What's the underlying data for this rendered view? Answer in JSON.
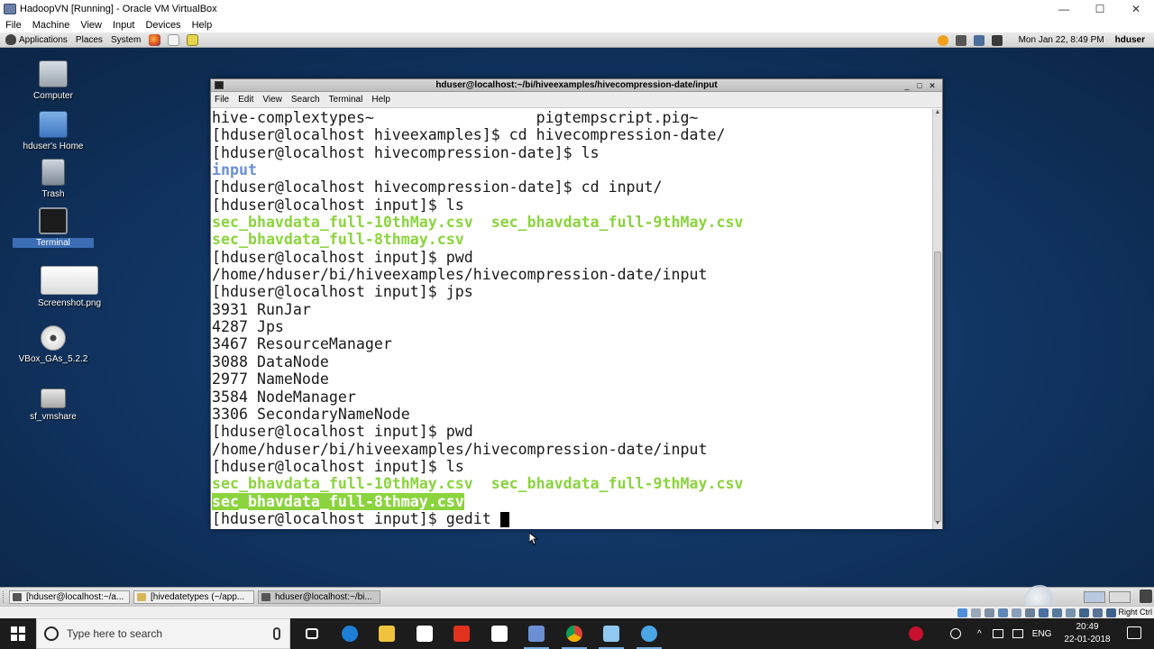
{
  "host_window": {
    "title": "HadoopVN [Running] - Oracle VM VirtualBox",
    "menu": [
      "File",
      "Machine",
      "View",
      "Input",
      "Devices",
      "Help"
    ],
    "controls": {
      "minimize": "—",
      "maximize": "☐",
      "close": "✕"
    }
  },
  "guest_panel": {
    "menus": [
      "Applications",
      "Places",
      "System"
    ],
    "clock": "Mon Jan 22,  8:49 PM",
    "user": "hduser"
  },
  "desktop_icons": [
    {
      "label": "Computer",
      "icon": "computer-icon",
      "selected": false
    },
    {
      "label": "hduser's Home",
      "icon": "home-folder-icon",
      "selected": false
    },
    {
      "label": "Trash",
      "icon": "trash-icon",
      "selected": false
    },
    {
      "label": "Terminal",
      "icon": "terminal-icon",
      "selected": true
    },
    {
      "label": "Screenshot.png",
      "icon": "image-file-icon",
      "selected": false
    },
    {
      "label": "VBox_GAs_5.2.2",
      "icon": "cd-icon",
      "selected": false
    },
    {
      "label": "sf_vmshare",
      "icon": "drive-icon",
      "selected": false
    }
  ],
  "terminal": {
    "title": "hduser@localhost:~/bi/hiveexamples/hivecompression-date/input",
    "menu": [
      "File",
      "Edit",
      "View",
      "Search",
      "Terminal",
      "Help"
    ],
    "lines": [
      [
        {
          "t": "hive-complextypes~                  pigtempscript.pig~",
          "c": ""
        }
      ],
      [
        {
          "t": "[hduser@localhost hiveexamples]$ cd hivecompression-date/",
          "c": ""
        }
      ],
      [
        {
          "t": "[hduser@localhost hivecompression-date]$ ls",
          "c": ""
        }
      ],
      [
        {
          "t": "input",
          "c": "blue"
        }
      ],
      [
        {
          "t": "[hduser@localhost hivecompression-date]$ cd input/",
          "c": ""
        }
      ],
      [
        {
          "t": "[hduser@localhost input]$ ls",
          "c": ""
        }
      ],
      [
        {
          "t": "sec_bhavdata_full-10thMay.csv",
          "c": "green"
        },
        {
          "t": "  ",
          "c": ""
        },
        {
          "t": "sec_bhavdata_full-9thMay.csv",
          "c": "green"
        }
      ],
      [
        {
          "t": "sec_bhavdata_full-8thmay.csv",
          "c": "green"
        }
      ],
      [
        {
          "t": "[hduser@localhost input]$ pwd",
          "c": ""
        }
      ],
      [
        {
          "t": "/home/hduser/bi/hiveexamples/hivecompression-date/input",
          "c": ""
        }
      ],
      [
        {
          "t": "[hduser@localhost input]$ jps",
          "c": ""
        }
      ],
      [
        {
          "t": "3931 RunJar",
          "c": ""
        }
      ],
      [
        {
          "t": "4287 Jps",
          "c": ""
        }
      ],
      [
        {
          "t": "3467 ResourceManager",
          "c": ""
        }
      ],
      [
        {
          "t": "3088 DataNode",
          "c": ""
        }
      ],
      [
        {
          "t": "2977 NameNode",
          "c": ""
        }
      ],
      [
        {
          "t": "3584 NodeManager",
          "c": ""
        }
      ],
      [
        {
          "t": "3306 SecondaryNameNode",
          "c": ""
        }
      ],
      [
        {
          "t": "[hduser@localhost input]$ pwd",
          "c": ""
        }
      ],
      [
        {
          "t": "/home/hduser/bi/hiveexamples/hivecompression-date/input",
          "c": ""
        }
      ],
      [
        {
          "t": "[hduser@localhost input]$ ls",
          "c": ""
        }
      ],
      [
        {
          "t": "sec_bhavdata_full-10thMay.csv",
          "c": "green"
        },
        {
          "t": "  ",
          "c": ""
        },
        {
          "t": "sec_bhavdata_full-9thMay.csv",
          "c": "green"
        }
      ],
      [
        {
          "t": "sec_bhavdata_full-8thmay.csv",
          "c": "hl"
        }
      ],
      [
        {
          "t": "[hduser@localhost input]$ gedit ",
          "c": ""
        },
        {
          "t": "",
          "c": "cursor"
        }
      ]
    ]
  },
  "guest_taskbar": {
    "buttons": [
      {
        "label": "[hduser@localhost:~/a...",
        "active": false
      },
      {
        "label": "[hivedatetypes (~/app...",
        "active": false
      },
      {
        "label": "hduser@localhost:~/bi...",
        "active": true
      }
    ]
  },
  "vbox_status": {
    "host_key": "Right Ctrl"
  },
  "windows_taskbar": {
    "search_placeholder": "Here to search",
    "search_full": "Type here to search",
    "apps": [
      {
        "name": "task-view-icon",
        "color": "#1c1c1c",
        "running": false
      },
      {
        "name": "edge-icon",
        "color": "#1f7fd6",
        "running": false
      },
      {
        "name": "file-explorer-icon",
        "color": "#f0c33c",
        "running": false
      },
      {
        "name": "store-icon",
        "color": "#ffffff",
        "running": false
      },
      {
        "name": "pdf-reader-icon",
        "color": "#e0321f",
        "running": false
      },
      {
        "name": "mail-icon",
        "color": "#ffffff",
        "running": false
      },
      {
        "name": "virtualbox-icon",
        "color": "#6b8fd4",
        "running": true
      },
      {
        "name": "chrome-icon",
        "color": "#4caf50",
        "running": true
      },
      {
        "name": "notepad-icon",
        "color": "#8fc8f0",
        "running": true
      },
      {
        "name": "snowflake-app-icon",
        "color": "#4aa6e6",
        "running": true
      }
    ],
    "lang": "ENG",
    "time": "20:49",
    "date": "22-01-2018"
  },
  "colors": {
    "term_green": "#8bd43e",
    "term_blue": "#6b8fd4",
    "desktop_blue": "#123766"
  }
}
